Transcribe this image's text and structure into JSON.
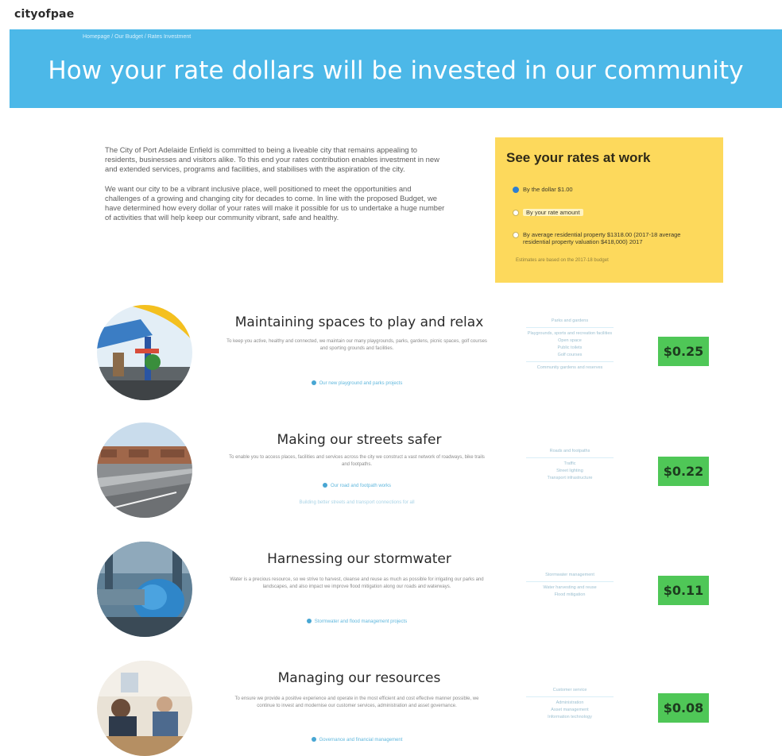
{
  "site": {
    "logo": "cityofpae"
  },
  "hero": {
    "breadcrumb": [
      "Homepage",
      "Our Budget",
      "Rates Investment"
    ],
    "title": "How your rate dollars will be invested in our community"
  },
  "intro": {
    "paragraphs": [
      "The City of Port Adelaide Enfield is committed to being a liveable city that remains appealing to residents, businesses and visitors alike. To this end your rates contribution enables investment in new and extended services, programs and facilities, and stabilises with the aspiration of the city.",
      "We want our city to be a vibrant inclusive place, well positioned to meet the opportunities and challenges of a growing and changing city for decades to come. In line with the proposed Budget, we have determined how every dollar of your rates will make it possible for us to undertake a huge number of activities that will help keep our community vibrant, safe and healthy."
    ]
  },
  "rates_panel": {
    "title": "See your rates at work",
    "options": [
      {
        "label": "By the dollar $1.00",
        "selected": true
      },
      {
        "label": "By your rate amount",
        "selected": false
      },
      {
        "label": "By average residential property $1318.00 (2017-18 average residential property valuation $418,000) 2017",
        "selected": false
      }
    ],
    "footnote": "Estimates are based on the 2017-18 budget"
  },
  "items": [
    {
      "title": "Maintaining spaces to play and relax",
      "description": "To keep you active, healthy and connected, we maintain our many playgrounds, parks, gardens, picnic spaces, golf courses and sporting grounds and facilities.",
      "link": "Our new playground and parks projects",
      "breakdown": [
        "Parks and gardens",
        "Playgrounds, sports and recreation facilities",
        "Open space",
        "Public toilets",
        "Golf courses",
        "Community gardens and reserves"
      ],
      "amount": "$0.25"
    },
    {
      "title": "Making our streets safer",
      "description": "To enable you to access places, facilities and services across the city we construct a vast network of roadways, bike trails and footpaths.",
      "link": "Our road and footpath works",
      "link2": "Building better streets and transport connections for all",
      "breakdown": [
        "Roads and footpaths",
        "Traffic",
        "Street lighting",
        "Transport infrastructure"
      ],
      "amount": "$0.22"
    },
    {
      "title": "Harnessing our stormwater",
      "description": "Water is a precious resource, so we strive to harvest, cleanse and reuse as much as possible for irrigating our parks and landscapes, and also impact we improve flood mitigation along our roads and waterways.",
      "link": "Stormwater and flood management projects",
      "breakdown": [
        "Stormwater management",
        "Water harvesting and reuse",
        "Flood mitigation"
      ],
      "amount": "$0.11"
    },
    {
      "title": "Managing our resources",
      "description": "To ensure we provide a positive experience and operate in the most efficient and cost effective manner possible, we continue to invest and modernise our customer services, administration and asset governance.",
      "link": "Governance and financial management",
      "breakdown": [
        "Customer service",
        "Administration",
        "Asset management",
        "Information technology"
      ],
      "amount": "$0.08"
    }
  ],
  "colors": {
    "hero": "#4cb8e8",
    "rates_panel": "#fdd95c",
    "amount_badge": "#4fc757"
  }
}
